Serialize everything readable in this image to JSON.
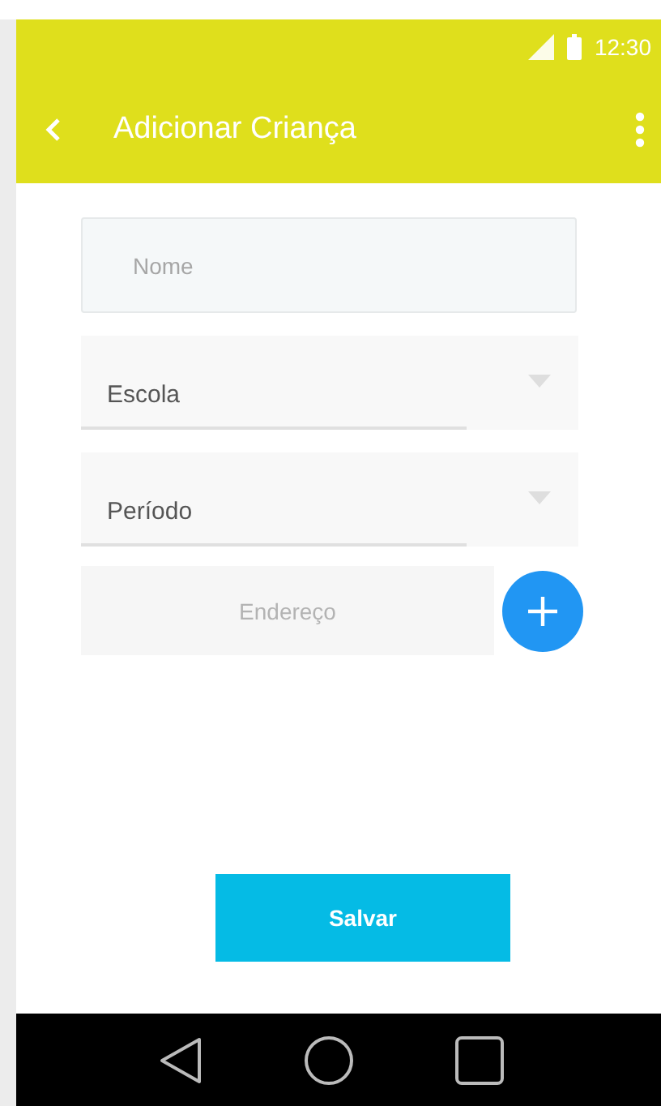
{
  "status_bar": {
    "time": "12:30"
  },
  "toolbar": {
    "title": "Adicionar Criança"
  },
  "form": {
    "name_field": {
      "placeholder": "Nome"
    },
    "dropdowns": [
      {
        "label": "Escola"
      },
      {
        "label": "Período"
      }
    ],
    "address_field": {
      "placeholder": "Endereço"
    }
  },
  "buttons": [
    "Salvar"
  ]
}
